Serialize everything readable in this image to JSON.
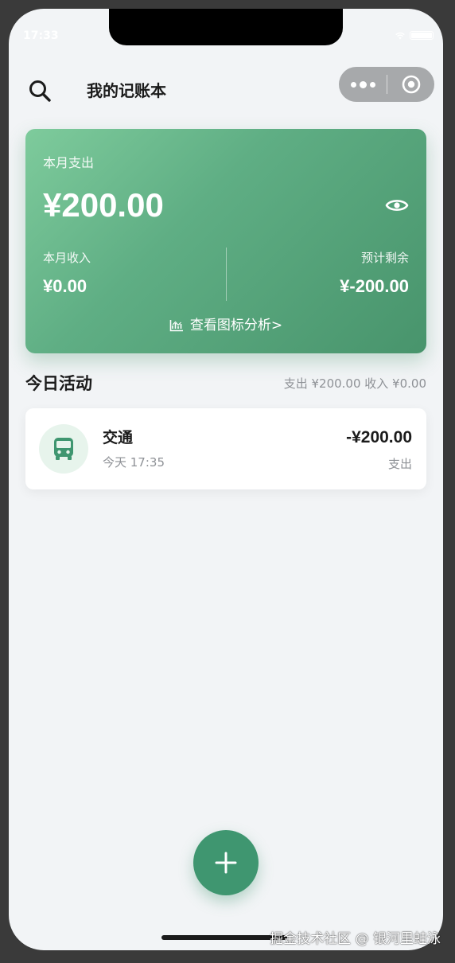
{
  "status_bar": {
    "time": "17:33"
  },
  "nav": {
    "title": "我的记账本",
    "search_icon": "search-icon",
    "more_icon": "more-dots-icon",
    "close_icon": "target-close-icon"
  },
  "summary_card": {
    "spend_label": "本月支出",
    "spend_amount": "¥200.00",
    "visibility_icon": "eye-icon",
    "income_label": "本月收入",
    "income_amount": "¥0.00",
    "remain_label": "预计剩余",
    "remain_amount": "¥-200.00",
    "chart_link_icon": "chart-icon",
    "chart_link_label": "查看图标分析",
    "chart_link_arrow": ">",
    "gradient_start": "#7ecb9c",
    "gradient_end": "#48946c"
  },
  "today": {
    "title": "今日活动",
    "summary": "支出 ¥200.00 收入 ¥0.00",
    "transactions": [
      {
        "icon": "bus-icon",
        "name": "交通",
        "time": "今天 17:35",
        "amount": "-¥200.00",
        "type": "支出"
      }
    ]
  },
  "fab": {
    "icon": "plus-icon"
  },
  "watermark": "掘金技术社区 @ 银河里蛙泳",
  "colors": {
    "accent": "#3f9670",
    "background": "#f2f4f6",
    "text_primary": "#1b1b1b",
    "text_secondary": "#8e9196",
    "icon_bg": "#e7f4ec"
  }
}
